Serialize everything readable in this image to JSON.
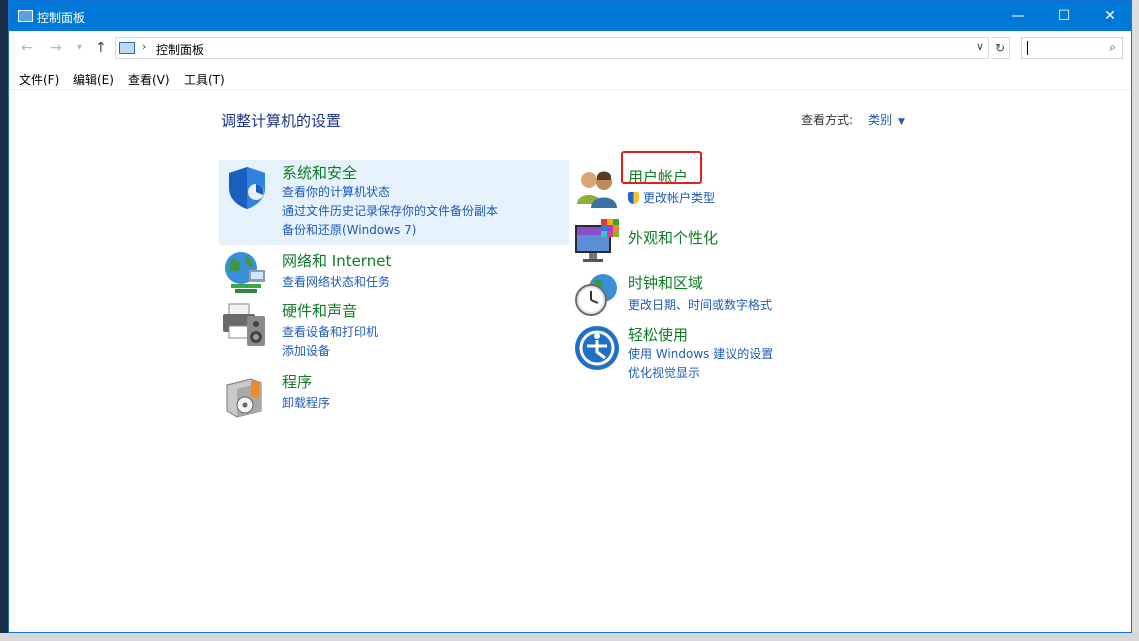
{
  "window": {
    "title": "控制面板",
    "minimize_glyph": "—",
    "maximize_glyph": "☐",
    "close_glyph": "✕"
  },
  "nav": {
    "back_glyph": "←",
    "forward_glyph": "→",
    "recent_glyph": "▾",
    "up_glyph": "↑",
    "breadcrumb_sep": "›",
    "breadcrumb": "控制面板",
    "dropdown_glyph": "∨",
    "refresh_glyph": "↻",
    "search_placeholder": "",
    "search_glyph": "⌕"
  },
  "menu": [
    "文件(F)",
    "编辑(E)",
    "查看(V)",
    "工具(T)"
  ],
  "page": {
    "title": "调整计算机的设置",
    "view_by_label": "查看方式:",
    "view_by_value": "类别",
    "view_by_arrow": "▼"
  },
  "categories_left": [
    {
      "title": "系统和安全",
      "icon": "shield-icon",
      "links": [
        "查看你的计算机状态",
        "通过文件历史记录保存你的文件备份副本",
        "备份和还原(Windows 7)"
      ]
    },
    {
      "title": "网络和 Internet",
      "icon": "globe-network-icon",
      "links": [
        "查看网络状态和任务"
      ]
    },
    {
      "title": "硬件和声音",
      "icon": "printer-speaker-icon",
      "links": [
        "查看设备和打印机",
        "添加设备"
      ]
    },
    {
      "title": "程序",
      "icon": "programs-box-icon",
      "links": [
        "卸载程序"
      ]
    }
  ],
  "categories_right": [
    {
      "title": "用户帐户",
      "icon": "users-icon",
      "links": [
        "更改帐户类型"
      ]
    },
    {
      "title": "外观和个性化",
      "icon": "monitor-palette-icon",
      "links": []
    },
    {
      "title": "时钟和区域",
      "icon": "clock-globe-icon",
      "links": [
        "更改日期、时间或数字格式"
      ]
    },
    {
      "title": "轻松使用",
      "icon": "ease-of-access-icon",
      "links": [
        "使用 Windows 建议的设置",
        "优化视觉显示"
      ]
    }
  ],
  "colors": {
    "titlebar": "#0078d7",
    "category_heading": "#117a26",
    "link": "#1e5ab4",
    "page_title": "#1e3287",
    "highlight": "#e5f1fb",
    "annotation_box": "#e02020"
  }
}
